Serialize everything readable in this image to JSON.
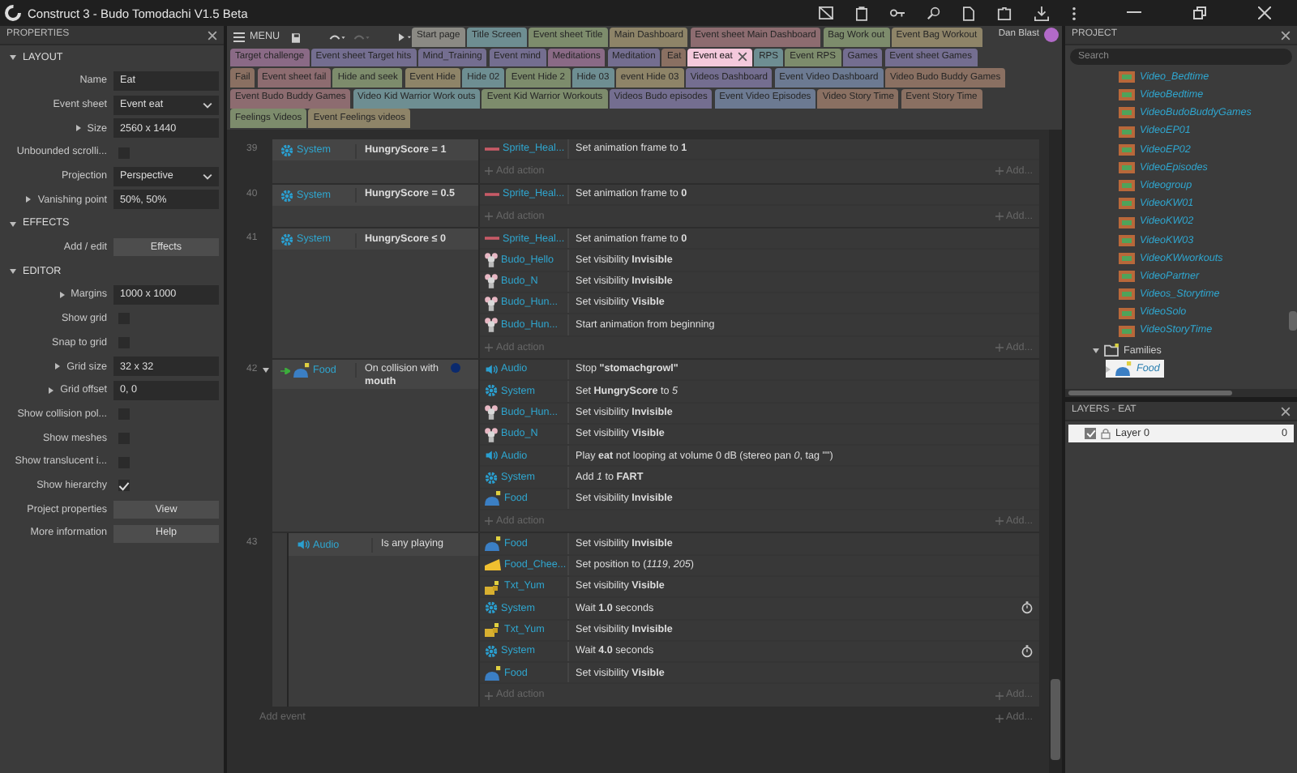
{
  "window": {
    "title": "Construct 3 - Budo Tomodachi V1.5 Beta"
  },
  "menu": {
    "label": "MENU"
  },
  "user": {
    "name": "Dan Blast"
  },
  "tab_rows": [
    [
      {
        "label": "Start page",
        "color": "#8b8a84",
        "selected": false
      },
      {
        "label": "Title Screen",
        "color": "#6e8e92",
        "selected": false
      },
      {
        "label": "Event sheet Title",
        "color": "#7d8c6c",
        "selected": false
      },
      {
        "label": "Main Dashboard",
        "color": "#8e8468",
        "selected": false
      },
      {
        "label": "Event sheet Main Dashboard",
        "color": "#8d6c70",
        "selected": false
      },
      {
        "label": "Bag Work out",
        "color": "#7d8c6c",
        "selected": false
      },
      {
        "label": "Event Bag Workout",
        "color": "#8e8468",
        "selected": false
      }
    ],
    [
      {
        "label": "Target challenge",
        "color": "#8a6a86",
        "selected": false
      },
      {
        "label": "Event sheet Target hits",
        "color": "#746e90",
        "selected": false
      },
      {
        "label": "Mind_Training",
        "color": "#746e90",
        "selected": false
      },
      {
        "label": "Event mind",
        "color": "#746e90",
        "selected": false
      },
      {
        "label": "Meditations",
        "color": "#8a6a86",
        "selected": false
      },
      {
        "label": "Meditation",
        "color": "#746e90",
        "selected": false
      },
      {
        "label": "Eat",
        "color": "#8a7062",
        "selected": false
      },
      {
        "label": "Event eat",
        "color": "#f4c9dc",
        "selected": true
      },
      {
        "label": "RPS",
        "color": "#6e8e92",
        "selected": false
      },
      {
        "label": "Event RPS",
        "color": "#7d8c6c",
        "selected": false
      },
      {
        "label": "Games",
        "color": "#746e90",
        "selected": false
      },
      {
        "label": "Event sheet Games",
        "color": "#746e90",
        "selected": false
      }
    ],
    [
      {
        "label": "Fail",
        "color": "#8a7062",
        "selected": false
      },
      {
        "label": "Event sheet fail",
        "color": "#8d6c70",
        "selected": false
      },
      {
        "label": "Hide and seek",
        "color": "#7d8c6c",
        "selected": false
      },
      {
        "label": "Event Hide",
        "color": "#8e8468",
        "selected": false
      },
      {
        "label": "Hide 02",
        "color": "#6e8e92",
        "selected": false
      },
      {
        "label": "Event Hide 2",
        "color": "#7d8c6c",
        "selected": false
      },
      {
        "label": "Hide 03",
        "color": "#6e8e92",
        "selected": false
      },
      {
        "label": "event Hide 03",
        "color": "#8e8468",
        "selected": false
      },
      {
        "label": "Videos Dashboard",
        "color": "#746e90",
        "selected": false
      },
      {
        "label": "Event Video Dashboard",
        "color": "#6c7a92",
        "selected": false
      },
      {
        "label": "Video Budo Buddy Games",
        "color": "#8a7062",
        "selected": false
      }
    ],
    [
      {
        "label": "Event Budo Buddy Games",
        "color": "#8d6c70",
        "selected": false
      },
      {
        "label": "Video Kid Warrior Work outs",
        "color": "#6e8e92",
        "selected": false
      },
      {
        "label": "Event Kid Warrior Workouts",
        "color": "#7d8c6c",
        "selected": false
      },
      {
        "label": "Videos Budo episodes",
        "color": "#746e90",
        "selected": false
      },
      {
        "label": "Event Video Episodes",
        "color": "#6c7a92",
        "selected": false
      },
      {
        "label": "Video Story Time",
        "color": "#8a7062",
        "selected": false
      },
      {
        "label": "Event Story Time",
        "color": "#8a7062",
        "selected": false
      }
    ],
    [
      {
        "label": "Feelings Videos",
        "color": "#7d8c6c",
        "selected": false
      },
      {
        "label": "Event Feelings videos",
        "color": "#8e8468",
        "selected": false
      }
    ]
  ],
  "properties": {
    "title": "PROPERTIES",
    "sections": [
      {
        "title": "LAYOUT",
        "expanded": true,
        "rows": [
          {
            "kind": "text",
            "label": "Name",
            "value": "Eat",
            "has_children": false
          },
          {
            "kind": "select",
            "label": "Event sheet",
            "value": "Event eat",
            "has_children": false
          },
          {
            "kind": "text",
            "label": "Size",
            "value": "2560 x 1440",
            "has_children": true
          },
          {
            "kind": "checkbox",
            "label": "Unbounded scrolli...",
            "checked": false,
            "has_children": false
          },
          {
            "kind": "select",
            "label": "Projection",
            "value": "Perspective",
            "has_children": false
          },
          {
            "kind": "text",
            "label": "Vanishing point",
            "value": "50%, 50%",
            "has_children": true
          }
        ]
      },
      {
        "title": "EFFECTS",
        "expanded": true,
        "rows": [
          {
            "kind": "button",
            "label": "Add / edit",
            "value": "Effects",
            "has_children": false
          }
        ]
      },
      {
        "title": "EDITOR",
        "expanded": true,
        "rows": [
          {
            "kind": "text",
            "label": "Margins",
            "value": "1000 x 1000",
            "has_children": true
          },
          {
            "kind": "checkbox",
            "label": "Show grid",
            "checked": false,
            "has_children": false
          },
          {
            "kind": "checkbox",
            "label": "Snap to grid",
            "checked": false,
            "has_children": false
          },
          {
            "kind": "text",
            "label": "Grid size",
            "value": "32 x 32",
            "has_children": true
          },
          {
            "kind": "text",
            "label": "Grid offset",
            "value": "0, 0",
            "has_children": true
          },
          {
            "kind": "checkbox",
            "label": "Show collision pol...",
            "checked": false,
            "has_children": false
          },
          {
            "kind": "checkbox",
            "label": "Show meshes",
            "checked": false,
            "has_children": false
          },
          {
            "kind": "checkbox",
            "label": "Show translucent i...",
            "checked": false,
            "has_children": false
          },
          {
            "kind": "checkbox",
            "label": "Show hierarchy",
            "checked": true,
            "has_children": false
          },
          {
            "kind": "button",
            "label": "Project properties",
            "value": "View",
            "has_children": false
          },
          {
            "kind": "button",
            "label": "More information",
            "value": "Help",
            "has_children": false
          }
        ]
      }
    ]
  },
  "event_sheet": {
    "events": [
      {
        "number": "39",
        "trigger": false,
        "conditions": [
          {
            "object": "System",
            "kind": "system",
            "text": "HungryScore = 1",
            "bold": true
          }
        ],
        "actions": [
          {
            "object": "Sprite_Heal...",
            "kind": "healthbar",
            "text": "Set animation frame to **1**",
            "timer": false
          }
        ],
        "add_action": "Add action",
        "add_other": "Add..."
      },
      {
        "number": "40",
        "trigger": false,
        "conditions": [
          {
            "object": "System",
            "kind": "system",
            "text": "HungryScore = 0.5",
            "bold": true
          }
        ],
        "actions": [
          {
            "object": "Sprite_Heal...",
            "kind": "healthbar",
            "text": "Set animation frame to **0**",
            "timer": false
          }
        ],
        "add_action": "Add action",
        "add_other": "Add..."
      },
      {
        "number": "41",
        "trigger": false,
        "conditions": [
          {
            "object": "System",
            "kind": "system",
            "text": "HungryScore ≤ 0",
            "bold": true
          }
        ],
        "actions": [
          {
            "object": "Sprite_Heal...",
            "kind": "healthbar",
            "text": "Set animation frame to **0**",
            "timer": false
          },
          {
            "object": "Budo_Hello",
            "kind": "character",
            "text": "Set visibility **Invisible**",
            "timer": false
          },
          {
            "object": "Budo_N",
            "kind": "character",
            "text": "Set visibility **Invisible**",
            "timer": false
          },
          {
            "object": "Budo_Hun...",
            "kind": "character",
            "text": "Set visibility **Visible**",
            "timer": false
          },
          {
            "object": "Budo_Hun...",
            "kind": "character",
            "text": "Start animation from beginning",
            "timer": false
          }
        ],
        "add_action": "Add action",
        "add_other": "Add..."
      },
      {
        "number": "42",
        "trigger": true,
        "expanded": true,
        "conditions": [
          {
            "object": "Food",
            "kind": "collision",
            "text": "On collision with **mouth**",
            "bold": false
          }
        ],
        "actions": [
          {
            "object": "Audio",
            "kind": "audio",
            "text": "Stop **\"stomachgrowl\"**",
            "timer": false
          },
          {
            "object": "System",
            "kind": "system",
            "text": "Set **HungryScore** to *5*",
            "timer": false
          },
          {
            "object": "Budo_Hun...",
            "kind": "character",
            "text": "Set visibility **Invisible**",
            "timer": false
          },
          {
            "object": "Budo_N",
            "kind": "character",
            "text": "Set visibility **Visible**",
            "timer": false
          },
          {
            "object": "Audio",
            "kind": "audio",
            "text": "Play **eat** not looping at volume 0 dB (stereo pan *0*, tag \"\")",
            "timer": false
          },
          {
            "object": "System",
            "kind": "system",
            "text": "Add *1* to **FART**",
            "timer": false
          },
          {
            "object": "Food",
            "kind": "food",
            "text": "Set visibility **Invisible**",
            "timer": false
          }
        ],
        "add_action": "Add action",
        "add_other": "Add...",
        "children": [
          {
            "number": "43",
            "trigger": false,
            "conditions": [
              {
                "object": "Audio",
                "kind": "audio",
                "text": "Is any playing",
                "bold": false
              }
            ],
            "actions": [
              {
                "object": "Food",
                "kind": "food",
                "text": "Set visibility **Invisible**",
                "timer": false
              },
              {
                "object": "Food_Chee...",
                "kind": "cheese",
                "text": "Set position to (*1119*, *205*)",
                "timer": false
              },
              {
                "object": "Txt_Yum",
                "kind": "text",
                "text": "Set visibility **Visible**",
                "timer": false
              },
              {
                "object": "System",
                "kind": "system",
                "text": "Wait **1.0** seconds",
                "timer": true
              },
              {
                "object": "Txt_Yum",
                "kind": "text",
                "text": "Set visibility **Invisible**",
                "timer": false
              },
              {
                "object": "System",
                "kind": "system",
                "text": "Wait **4.0** seconds",
                "timer": true
              },
              {
                "object": "Food",
                "kind": "food",
                "text": "Set visibility **Visible**",
                "timer": false
              }
            ],
            "add_action": "Add action",
            "add_other": "Add..."
          }
        ]
      }
    ],
    "add_event": "Add event",
    "add_other": "Add..."
  },
  "project": {
    "title": "PROJECT",
    "search": {
      "placeholder": "Search"
    },
    "tree": [
      {
        "label": "Video_Bedtime",
        "kind": "sprite",
        "selected": false
      },
      {
        "label": "VideoBedtime",
        "kind": "sprite",
        "selected": false
      },
      {
        "label": "VideoBudoBuddyGames",
        "kind": "sprite",
        "selected": false
      },
      {
        "label": "VideoEP01",
        "kind": "sprite",
        "selected": false
      },
      {
        "label": "VideoEP02",
        "kind": "sprite",
        "selected": false
      },
      {
        "label": "VideoEpisodes",
        "kind": "sprite",
        "selected": false
      },
      {
        "label": "Videogroup",
        "kind": "sprite",
        "selected": false
      },
      {
        "label": "VideoKW01",
        "kind": "sprite",
        "selected": false
      },
      {
        "label": "VideoKW02",
        "kind": "sprite",
        "selected": false
      },
      {
        "label": "VideoKW03",
        "kind": "sprite",
        "selected": false
      },
      {
        "label": "VideoKWworkouts",
        "kind": "sprite",
        "selected": false
      },
      {
        "label": "VideoPartner",
        "kind": "sprite",
        "selected": false
      },
      {
        "label": "Videos_Storytime",
        "kind": "sprite",
        "selected": false
      },
      {
        "label": "VideoSolo",
        "kind": "sprite",
        "selected": false
      },
      {
        "label": "VideoStoryTime",
        "kind": "sprite",
        "selected": false
      },
      {
        "label": "Families",
        "kind": "folder",
        "expanded": true,
        "selected": false,
        "children": [
          {
            "label": "Food",
            "kind": "family",
            "expanded": false,
            "selected": true
          }
        ]
      }
    ]
  },
  "layers": {
    "title": "LAYERS - EAT",
    "items": [
      {
        "name": "Layer 0",
        "count": "0",
        "visible": true,
        "selected": true
      }
    ]
  }
}
